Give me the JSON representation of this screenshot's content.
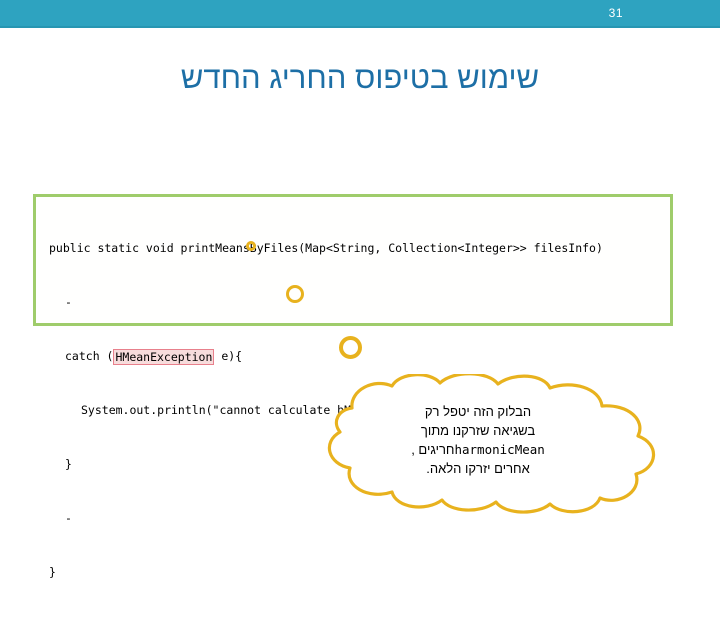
{
  "slide": {
    "number": "31",
    "title": "שימוש בטיפוס החריג החדש"
  },
  "code": {
    "line1": "public static void printMeansByFiles(Map<String, Collection<Integer>> filesInfo)",
    "line2": "-",
    "line3_before": "catch (",
    "line3_highlight": "HMeanException",
    "line3_after": " e){",
    "line4": "System.out.println(\"cannot calculate hMean for file \" +  mapEntry.getKey());",
    "line5": "}",
    "line6": "-",
    "line7": "}"
  },
  "callout": {
    "line1": "הבלוק הזה יטפל רק",
    "line2": "בשגיאה שזרקנו מתוך",
    "line3_rtl_prefix": "חריגים ,",
    "line3_mono": "harmonicMean",
    "line4": "אחרים יזרקו הלאה."
  },
  "colors": {
    "top_bar": "#2EA3C0",
    "title": "#1D6FA6",
    "code_border": "#9FCC6B",
    "callout_outline": "#E8B21E",
    "highlight_border": "#E8808C",
    "highlight_fill": "#F7DCDC"
  }
}
